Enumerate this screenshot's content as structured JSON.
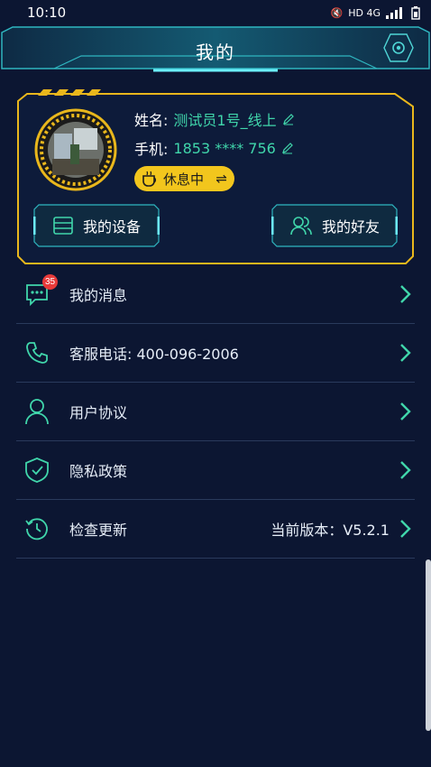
{
  "status_bar": {
    "time": "10:10",
    "signal_text": "HD 4G"
  },
  "header": {
    "title": "我的"
  },
  "profile": {
    "name_label": "姓名:",
    "name_value": "测试员1号_线上",
    "phone_label": "手机:",
    "phone_value": "1853 **** 756",
    "status_text": "休息中",
    "status_switch": "⇌",
    "devices_label": "我的设备",
    "friends_label": "我的好友"
  },
  "menu": {
    "items": [
      {
        "label": "我的消息",
        "badge": "35",
        "extra": ""
      },
      {
        "label": "客服电话: 400-096-2006",
        "extra": ""
      },
      {
        "label": "用户协议",
        "extra": ""
      },
      {
        "label": "隐私政策",
        "extra": ""
      },
      {
        "label": "检查更新",
        "extra": "当前版本：V5.2.1"
      }
    ]
  },
  "colors": {
    "accent": "#40d6ab",
    "gold": "#f2c61d",
    "background": "#0c1632"
  }
}
